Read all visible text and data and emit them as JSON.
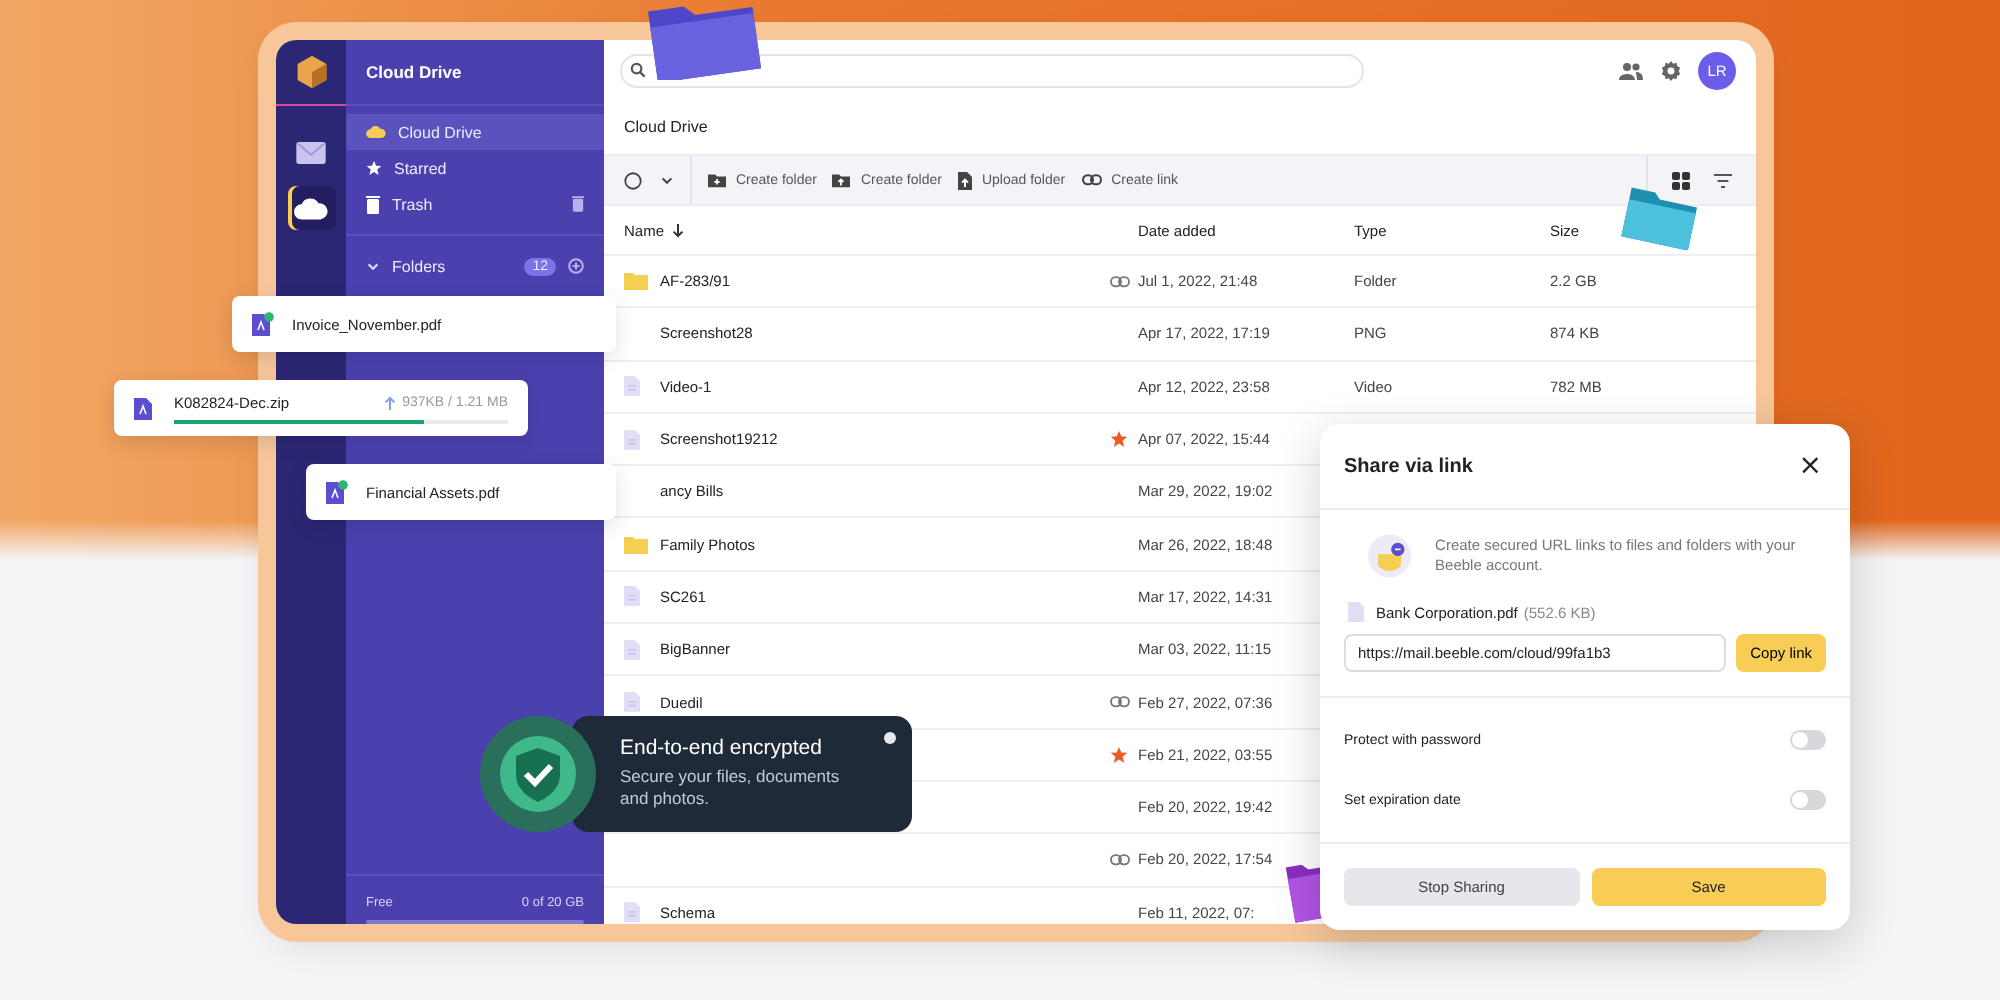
{
  "rail": [
    {
      "kind": "mail",
      "selected": false
    },
    {
      "kind": "cloud",
      "selected": true
    }
  ],
  "sidebar": {
    "title": "Cloud Drive",
    "items": [
      {
        "label": "Cloud Drive",
        "selected": true
      },
      {
        "label": "Starred",
        "selected": false
      },
      {
        "label": "Trash",
        "selected": false
      }
    ],
    "folders": {
      "label": "Folders",
      "count": "12",
      "expanded": true
    },
    "storage": {
      "label": "Free",
      "used": "0 of 20 GB"
    }
  },
  "topbar": {
    "avatar": "LR"
  },
  "breadcrumb": "Cloud Drive",
  "toolbar": {
    "select_all": {
      "checked": false
    },
    "actions": [
      {
        "label": "Create folder"
      },
      {
        "label": "Create folder"
      },
      {
        "label": "Upload folder"
      },
      {
        "label": "Create link"
      }
    ]
  },
  "table": {
    "columns": [
      {
        "label": "Name",
        "sorted": true
      },
      {
        "label": "Date added",
        "sorted": false
      },
      {
        "label": "Type",
        "sorted": false
      },
      {
        "label": "Size",
        "sorted": false
      }
    ],
    "rows": [
      {
        "name": "AF-283/91",
        "kind": "folder",
        "shared": true,
        "starred": false,
        "date": "Jul 1, 2022, 21:48",
        "type": "Folder",
        "size": "2.2 GB"
      },
      {
        "name": "Screenshot28",
        "shared": false,
        "starred": false,
        "date": "Apr 17, 2022, 17:19",
        "type": "PNG",
        "size": "874 KB"
      },
      {
        "name": "Video-1",
        "kind": "file",
        "shared": false,
        "starred": false,
        "date": "Apr 12, 2022, 23:58",
        "type": "Video",
        "size": "782 MB"
      },
      {
        "name": "Screenshot19212",
        "kind": "file",
        "shared": false,
        "starred": true,
        "date": "Apr 07, 2022, 15:44"
      },
      {
        "name": "ancy Bills",
        "shared": false,
        "starred": false,
        "date": "Mar 29, 2022, 19:02"
      },
      {
        "name": "Family Photos",
        "kind": "folder",
        "shared": false,
        "starred": false,
        "date": "Mar 26, 2022, 18:48"
      },
      {
        "name": "SC261",
        "kind": "file",
        "shared": false,
        "starred": false,
        "date": "Mar 17, 2022, 14:31"
      },
      {
        "name": "BigBanner",
        "kind": "file",
        "shared": false,
        "starred": false,
        "date": "Mar 03, 2022, 11:15"
      },
      {
        "name": "Duedil",
        "kind": "file",
        "shared": true,
        "starred": false,
        "date": "Feb 27, 2022, 07:36"
      },
      {
        "shared": false,
        "starred": true,
        "date": "Feb 21, 2022, 03:55"
      },
      {
        "shared": false,
        "starred": false,
        "date": "Feb 20, 2022, 19:42"
      },
      {
        "shared": true,
        "starred": false,
        "date": "Feb 20, 2022, 17:54"
      },
      {
        "name": "Schema",
        "kind": "file",
        "shared": false,
        "starred": false,
        "date": "Feb 11, 2022, 07:"
      }
    ]
  },
  "floating_files": [
    {
      "name": "Invoice_November.pdf",
      "kind": "done"
    },
    {
      "name": "K082824-Dec.zip",
      "kind": "uploading",
      "progress": "937KB / 1.21 MB",
      "level": 0.75
    },
    {
      "name": "Financial Assets.pdf",
      "kind": "done"
    }
  ],
  "encryption_card": {
    "title": "End-to-end encrypted",
    "text": "Secure your files, documents and photos."
  },
  "share_dialog": {
    "title": "Share via link",
    "close": "×",
    "intro": "Create secured URL links to files and folders with your Beeble account.",
    "file": {
      "name": "Bank Corporation.pdf",
      "size": "(552.6 KB)"
    },
    "url": "https://mail.beeble.com/cloud/99fa1b3",
    "copy_button": "Copy link",
    "toggles": [
      {
        "label": "Protect with password",
        "on": false
      },
      {
        "label": "Set expiration date",
        "on": false
      }
    ],
    "buttons": [
      {
        "label": "Stop Sharing",
        "kind": "secondary"
      },
      {
        "label": "Save",
        "kind": "primary"
      }
    ]
  }
}
